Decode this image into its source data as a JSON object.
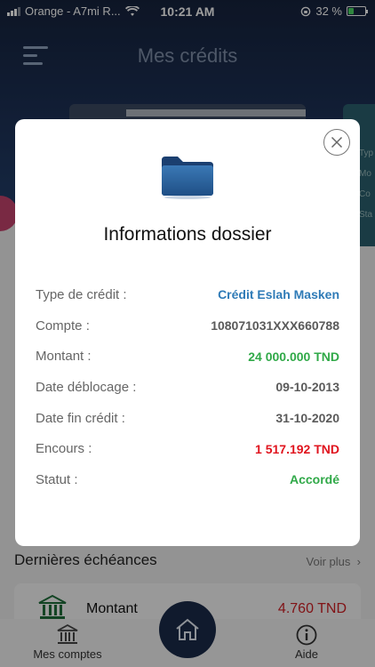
{
  "status_bar": {
    "carrier": "Orange - A7mi R...",
    "time": "10:21 AM",
    "battery": "32 %",
    "battery_level": 0.32
  },
  "header": {
    "title": "Mes crédits"
  },
  "background": {
    "side_card_labels": [
      "Typ",
      "Mo",
      "Co",
      "Sta"
    ],
    "section_title": "Dernières échéances",
    "see_more": "Voir plus",
    "item_label": "Montant",
    "item_amount": "4.760 TND"
  },
  "tabbar": {
    "accounts": "Mes comptes",
    "help": "Aide"
  },
  "modal": {
    "title": "Informations dossier",
    "rows": [
      {
        "label": "Type de crédit :",
        "value": "Crédit Eslah Masken"
      },
      {
        "label": "Compte :",
        "value": "108071031XXX660788"
      },
      {
        "label": "Montant :",
        "value": "24 000.000 TND"
      },
      {
        "label": "Date déblocage :",
        "value": "09-10-2013"
      },
      {
        "label": "Date fin crédit :",
        "value": "31-10-2020"
      },
      {
        "label": "Encours :",
        "value": "1 517.192 TND"
      },
      {
        "label": "Statut :",
        "value": "Accordé"
      }
    ]
  },
  "colors": {
    "navy": "#1b2b4a",
    "blue_value": "#2f7bb7",
    "green_value": "#30a948",
    "red_value": "#e0141e"
  }
}
